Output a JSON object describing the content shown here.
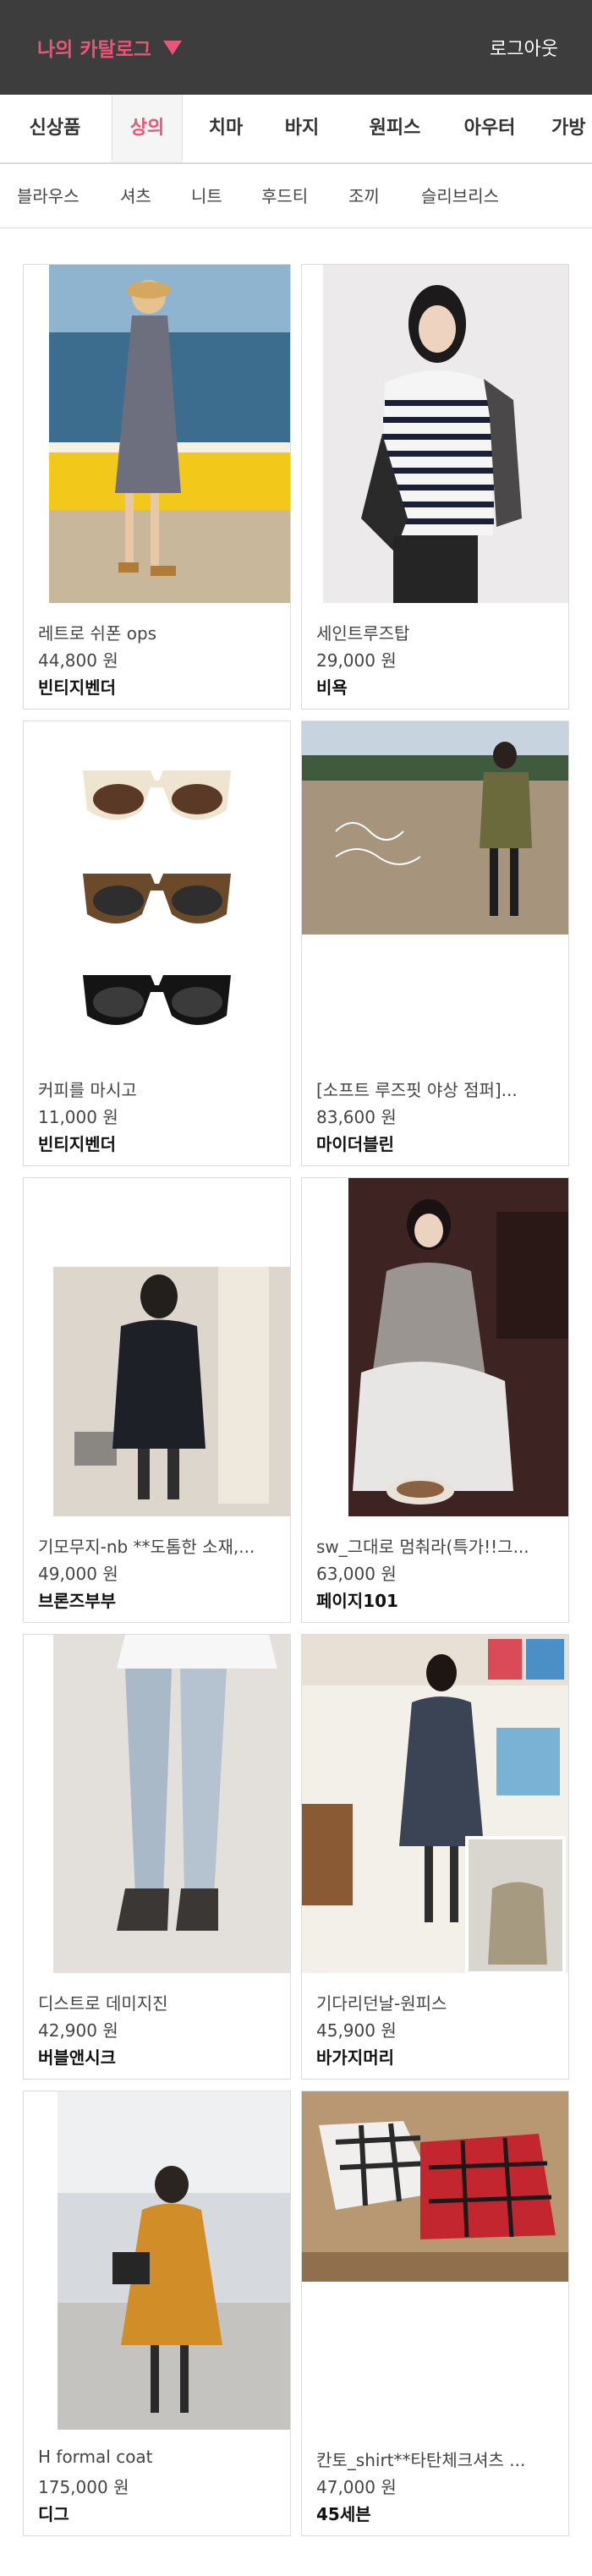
{
  "header": {
    "title": "나의 카탈로그",
    "logout_label": "로그아웃"
  },
  "colors": {
    "accent": "#ea5577",
    "header_bg": "#3d3d3d"
  },
  "categories": [
    "신상품",
    "상의",
    "치마",
    "바지",
    "원피스",
    "아우터",
    "가방"
  ],
  "active_category": "상의",
  "subcategories": [
    "블라우스",
    "셔츠",
    "니트",
    "후드티",
    "조끼",
    "슬리브리스"
  ],
  "products": [
    {
      "name": "레트로 쉬폰 ops",
      "price": "44,800 원",
      "shop": "빈티지벤더"
    },
    {
      "name": "세인트루즈탑",
      "price": "29,000 원",
      "shop": "비욕"
    },
    {
      "name": "커피를 마시고",
      "price": "11,000 원",
      "shop": "빈티지벤더"
    },
    {
      "name": "[소프트 루즈핏 야상 점퍼]...",
      "price": "83,600 원",
      "shop": "마이더블린"
    },
    {
      "name": "기모무지-nb **도톰한 소재,...",
      "price": "49,000 원",
      "shop": "브론즈부부"
    },
    {
      "name": "sw_그대로 멈춰라(특가!!그...",
      "price": "63,000 원",
      "shop": "페이지101"
    },
    {
      "name": "디스트로 데미지진",
      "price": "42,900 원",
      "shop": "버블앤시크"
    },
    {
      "name": "기다리던날-원피스",
      "price": "45,900 원",
      "shop": "바가지머리"
    },
    {
      "name": "H formal coat",
      "price": "175,000 원",
      "shop": "디그"
    },
    {
      "name": "칸토_shirt**타탄체크셔츠 ...",
      "price": "47,000 원",
      "shop": "45세븐"
    }
  ]
}
